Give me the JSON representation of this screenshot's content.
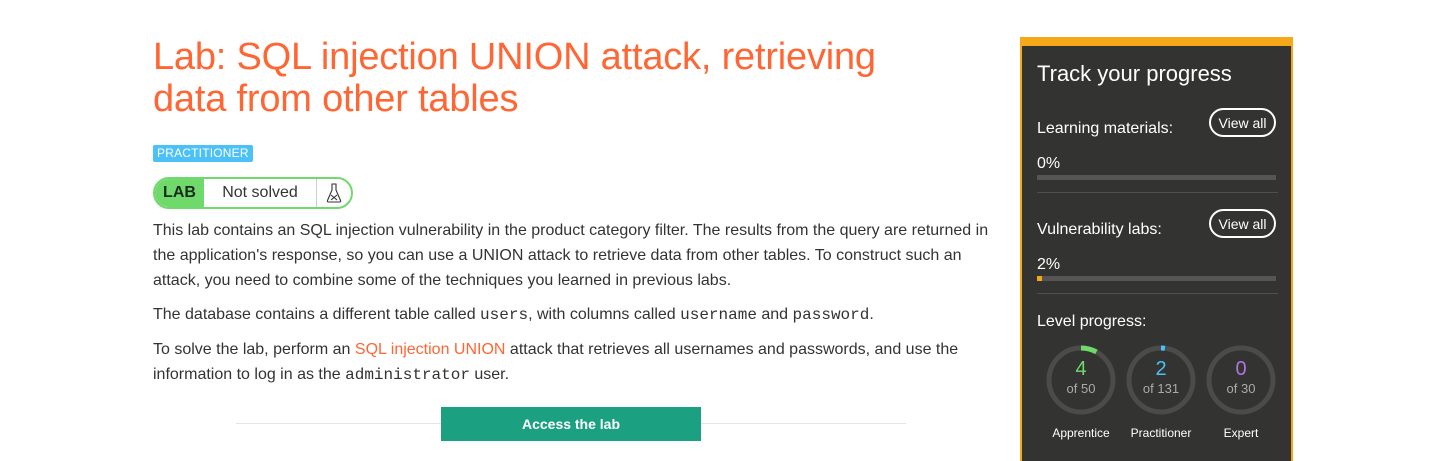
{
  "lab": {
    "title_line1": "Lab: SQL injection UNION attack, retrieving",
    "title_line2": "data from other tables",
    "level_badge": "PRACTITIONER",
    "status_tag": "LAB",
    "status_text": "Not solved",
    "status_icon": "flask-icon"
  },
  "description": {
    "p1": "This lab contains an SQL injection vulnerability in the product category filter. The results from the query are returned in the application's response, so you can use a UNION attack to retrieve data from other tables. To construct such an attack, you need to combine some of the techniques you learned in previous labs.",
    "p2_before": "The database contains a different table called ",
    "p2_code1": "users",
    "p2_mid": ", with columns called ",
    "p2_code2": "username",
    "p2_and": " and ",
    "p2_code3": "password",
    "p2_end": ".",
    "p3_before": "To solve the lab, perform an ",
    "p3_link": "SQL injection UNION",
    "p3_mid": " attack that retrieves all usernames and passwords, and use the information to log in as the ",
    "p3_code": "administrator",
    "p3_end": " user."
  },
  "access_button": "Access the lab",
  "progress": {
    "title": "Track your progress",
    "learning": {
      "label": "Learning materials:",
      "view_all": "View all",
      "percent": "0%",
      "value": 0
    },
    "vuln": {
      "label": "Vulnerability labs:",
      "view_all": "View all",
      "percent": "2%",
      "value": 0.02
    },
    "level_label": "Level progress:",
    "levels": [
      {
        "count": "4",
        "total": "of 50",
        "name": "Apprentice",
        "color": "#70d96b",
        "fraction": 0.08
      },
      {
        "count": "2",
        "total": "of 131",
        "name": "Practitioner",
        "color": "#4cc1f7",
        "fraction": 0.015
      },
      {
        "count": "0",
        "total": "of 30",
        "name": "Expert",
        "color": "#b374e0",
        "fraction": 0
      }
    ]
  },
  "colors": {
    "accent": "#ff6633",
    "sidebar_border": "#f6a819",
    "button_green": "#1ba181",
    "lab_green": "#70d96b"
  }
}
